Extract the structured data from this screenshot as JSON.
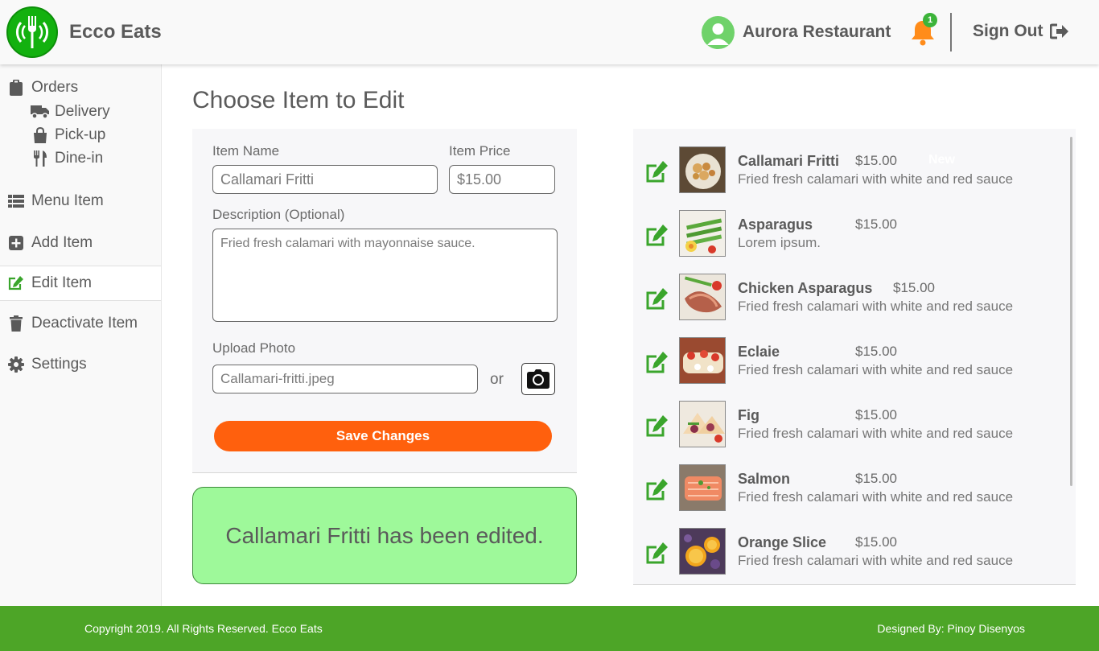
{
  "header": {
    "brand": "Ecco Eats",
    "user_name": "Aurora Restaurant",
    "notification_count": "1",
    "sign_out": "Sign Out",
    "colors": {
      "brand_green": "#13b10f",
      "bell_orange": "#ff8c1a"
    }
  },
  "sidebar": {
    "orders": "Orders",
    "delivery": "Delivery",
    "pickup": "Pick-up",
    "dinein": "Dine-in",
    "menu_item": "Menu Item",
    "add_item": "Add Item",
    "edit_item": "Edit Item",
    "deactivate_item": "Deactivate Item",
    "settings": "Settings"
  },
  "main": {
    "title": "Choose Item to Edit",
    "form": {
      "name_label": "Item Name",
      "name_value": "Callamari Fritti",
      "price_label": "Item Price",
      "price_value": "$15.00",
      "desc_label": "Description (Optional)",
      "desc_value": "Fried fresh calamari with mayonnaise sauce.",
      "upload_label": "Upload Photo",
      "upload_value": "Callamari-fritti.jpeg",
      "or_text": "or",
      "save_label": "Save Changes"
    },
    "alert_text": "Callamari Fritti has been edited."
  },
  "items": [
    {
      "name": "Callamari Fritti",
      "price": "$15.00",
      "desc": "Fried fresh calamari with white and red sauce",
      "tag": "New"
    },
    {
      "name": "Asparagus",
      "price": "$15.00",
      "desc": "Lorem ipsum."
    },
    {
      "name": "Chicken Asparagus",
      "price": "$15.00",
      "desc": "Fried fresh calamari with white and red sauce"
    },
    {
      "name": "Eclaie",
      "price": "$15.00",
      "desc": "Fried fresh calamari with white and red sauce"
    },
    {
      "name": "Fig",
      "price": "$15.00",
      "desc": "Fried fresh calamari with white and red sauce"
    },
    {
      "name": "Salmon",
      "price": "$15.00",
      "desc": "Fried fresh calamari with white and red sauce"
    },
    {
      "name": "Orange Slice",
      "price": "$15.00",
      "desc": "Fried fresh calamari with white and red sauce"
    }
  ],
  "footer": {
    "copyright": "Copyright 2019. All Rights Reserved. Ecco Eats",
    "designed_by": "Designed By: Pinoy Disenyos"
  }
}
